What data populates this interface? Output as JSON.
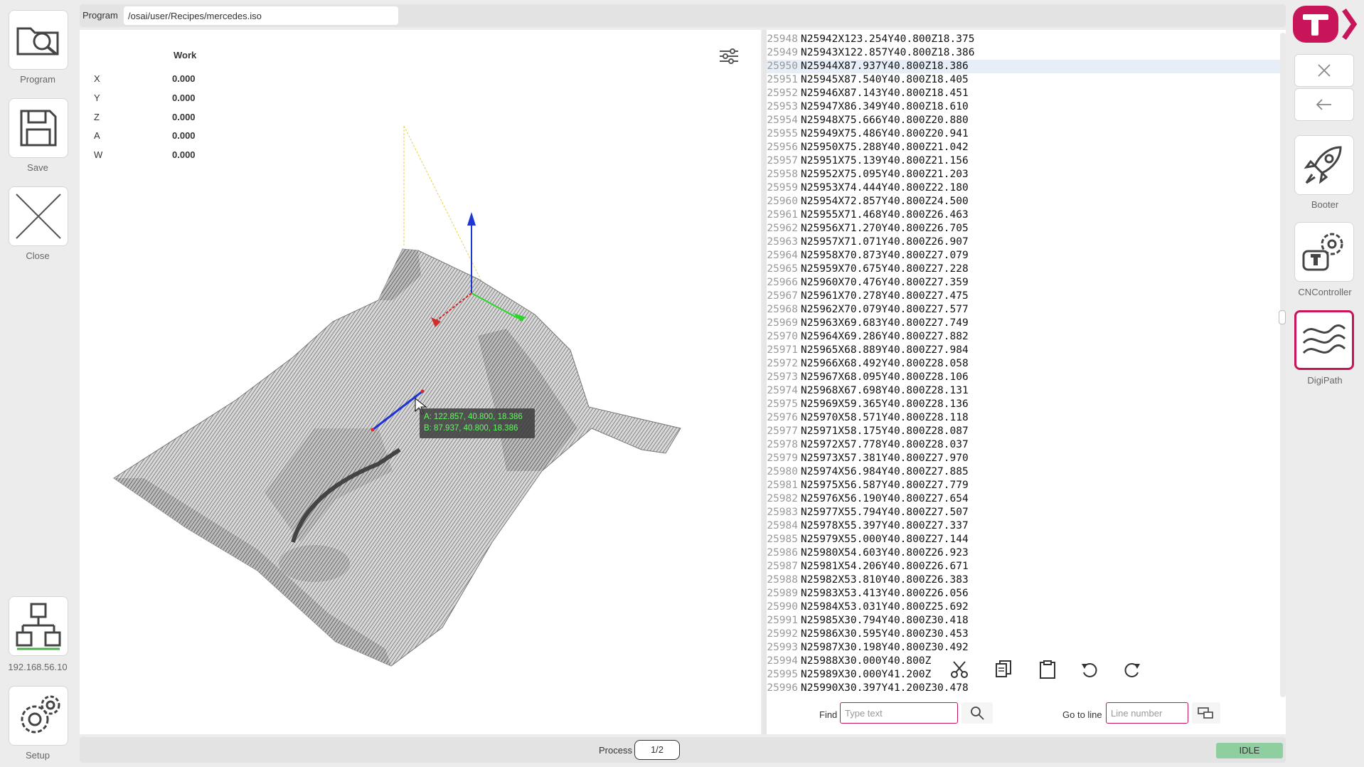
{
  "left_sidebar": {
    "items": [
      {
        "label": "Program",
        "icon": "folder-search-icon"
      },
      {
        "label": "Save",
        "icon": "save-icon"
      },
      {
        "label": "Close",
        "icon": "close-icon"
      }
    ],
    "network": {
      "label": "192.168.56.10",
      "icon": "network-icon"
    },
    "setup": {
      "label": "Setup",
      "icon": "gear-icon"
    }
  },
  "right_sidebar": {
    "items": [
      {
        "label": "Booter",
        "icon": "rocket-icon"
      },
      {
        "label": "CNController",
        "icon": "cnc-controller-icon"
      },
      {
        "label": "DigiPath",
        "icon": "digipath-icon"
      }
    ],
    "accent_color": "#c8155a"
  },
  "program_bar": {
    "label": "Program",
    "path": "/osai/user/Recipes/mercedes.iso"
  },
  "coordinates": {
    "header": "Work",
    "rows": [
      {
        "axis": "X",
        "value": "0.000"
      },
      {
        "axis": "Y",
        "value": "0.000"
      },
      {
        "axis": "Z",
        "value": "0.000"
      },
      {
        "axis": "A",
        "value": "0.000"
      },
      {
        "axis": "W",
        "value": "0.000"
      }
    ]
  },
  "tooltip": {
    "a": "A: 122.857, 40.800, 18.386",
    "b": "B: 87.937, 40.800, 18.386"
  },
  "code": {
    "highlighted_line": "25950",
    "lines": [
      {
        "n": "25948",
        "t": "N25942X123.254Y40.800Z18.375"
      },
      {
        "n": "25949",
        "t": "N25943X122.857Y40.800Z18.386"
      },
      {
        "n": "25950",
        "t": "N25944X87.937Y40.800Z18.386"
      },
      {
        "n": "25951",
        "t": "N25945X87.540Y40.800Z18.405"
      },
      {
        "n": "25952",
        "t": "N25946X87.143Y40.800Z18.451"
      },
      {
        "n": "25953",
        "t": "N25947X86.349Y40.800Z18.610"
      },
      {
        "n": "25954",
        "t": "N25948X75.666Y40.800Z20.880"
      },
      {
        "n": "25955",
        "t": "N25949X75.486Y40.800Z20.941"
      },
      {
        "n": "25956",
        "t": "N25950X75.288Y40.800Z21.042"
      },
      {
        "n": "25957",
        "t": "N25951X75.139Y40.800Z21.156"
      },
      {
        "n": "25958",
        "t": "N25952X75.095Y40.800Z21.203"
      },
      {
        "n": "25959",
        "t": "N25953X74.444Y40.800Z22.180"
      },
      {
        "n": "25960",
        "t": "N25954X72.857Y40.800Z24.500"
      },
      {
        "n": "25961",
        "t": "N25955X71.468Y40.800Z26.463"
      },
      {
        "n": "25962",
        "t": "N25956X71.270Y40.800Z26.705"
      },
      {
        "n": "25963",
        "t": "N25957X71.071Y40.800Z26.907"
      },
      {
        "n": "25964",
        "t": "N25958X70.873Y40.800Z27.079"
      },
      {
        "n": "25965",
        "t": "N25959X70.675Y40.800Z27.228"
      },
      {
        "n": "25966",
        "t": "N25960X70.476Y40.800Z27.359"
      },
      {
        "n": "25967",
        "t": "N25961X70.278Y40.800Z27.475"
      },
      {
        "n": "25968",
        "t": "N25962X70.079Y40.800Z27.577"
      },
      {
        "n": "25969",
        "t": "N25963X69.683Y40.800Z27.749"
      },
      {
        "n": "25970",
        "t": "N25964X69.286Y40.800Z27.882"
      },
      {
        "n": "25971",
        "t": "N25965X68.889Y40.800Z27.984"
      },
      {
        "n": "25972",
        "t": "N25966X68.492Y40.800Z28.058"
      },
      {
        "n": "25973",
        "t": "N25967X68.095Y40.800Z28.106"
      },
      {
        "n": "25974",
        "t": "N25968X67.698Y40.800Z28.131"
      },
      {
        "n": "25975",
        "t": "N25969X59.365Y40.800Z28.136"
      },
      {
        "n": "25976",
        "t": "N25970X58.571Y40.800Z28.118"
      },
      {
        "n": "25977",
        "t": "N25971X58.175Y40.800Z28.087"
      },
      {
        "n": "25978",
        "t": "N25972X57.778Y40.800Z28.037"
      },
      {
        "n": "25979",
        "t": "N25973X57.381Y40.800Z27.970"
      },
      {
        "n": "25980",
        "t": "N25974X56.984Y40.800Z27.885"
      },
      {
        "n": "25981",
        "t": "N25975X56.587Y40.800Z27.779"
      },
      {
        "n": "25982",
        "t": "N25976X56.190Y40.800Z27.654"
      },
      {
        "n": "25983",
        "t": "N25977X55.794Y40.800Z27.507"
      },
      {
        "n": "25984",
        "t": "N25978X55.397Y40.800Z27.337"
      },
      {
        "n": "25985",
        "t": "N25979X55.000Y40.800Z27.144"
      },
      {
        "n": "25986",
        "t": "N25980X54.603Y40.800Z26.923"
      },
      {
        "n": "25987",
        "t": "N25981X54.206Y40.800Z26.671"
      },
      {
        "n": "25988",
        "t": "N25982X53.810Y40.800Z26.383"
      },
      {
        "n": "25989",
        "t": "N25983X53.413Y40.800Z26.056"
      },
      {
        "n": "25990",
        "t": "N25984X53.031Y40.800Z25.692"
      },
      {
        "n": "25991",
        "t": "N25985X30.794Y40.800Z30.418"
      },
      {
        "n": "25992",
        "t": "N25986X30.595Y40.800Z30.453"
      },
      {
        "n": "25993",
        "t": "N25987X30.198Y40.800Z30.492"
      },
      {
        "n": "25994",
        "t": "N25988X30.000Y40.800Z"
      },
      {
        "n": "25995",
        "t": "N25989X30.000Y41.200Z"
      },
      {
        "n": "25996",
        "t": "N25990X30.397Y41.200Z30.478"
      }
    ]
  },
  "search": {
    "find_label": "Find",
    "find_placeholder": "Type text",
    "goto_label": "Go to line",
    "goto_placeholder": "Line number"
  },
  "status": {
    "process_label": "Process",
    "process_value": "1/2",
    "state": "IDLE",
    "state_color": "#8fcf9f"
  }
}
